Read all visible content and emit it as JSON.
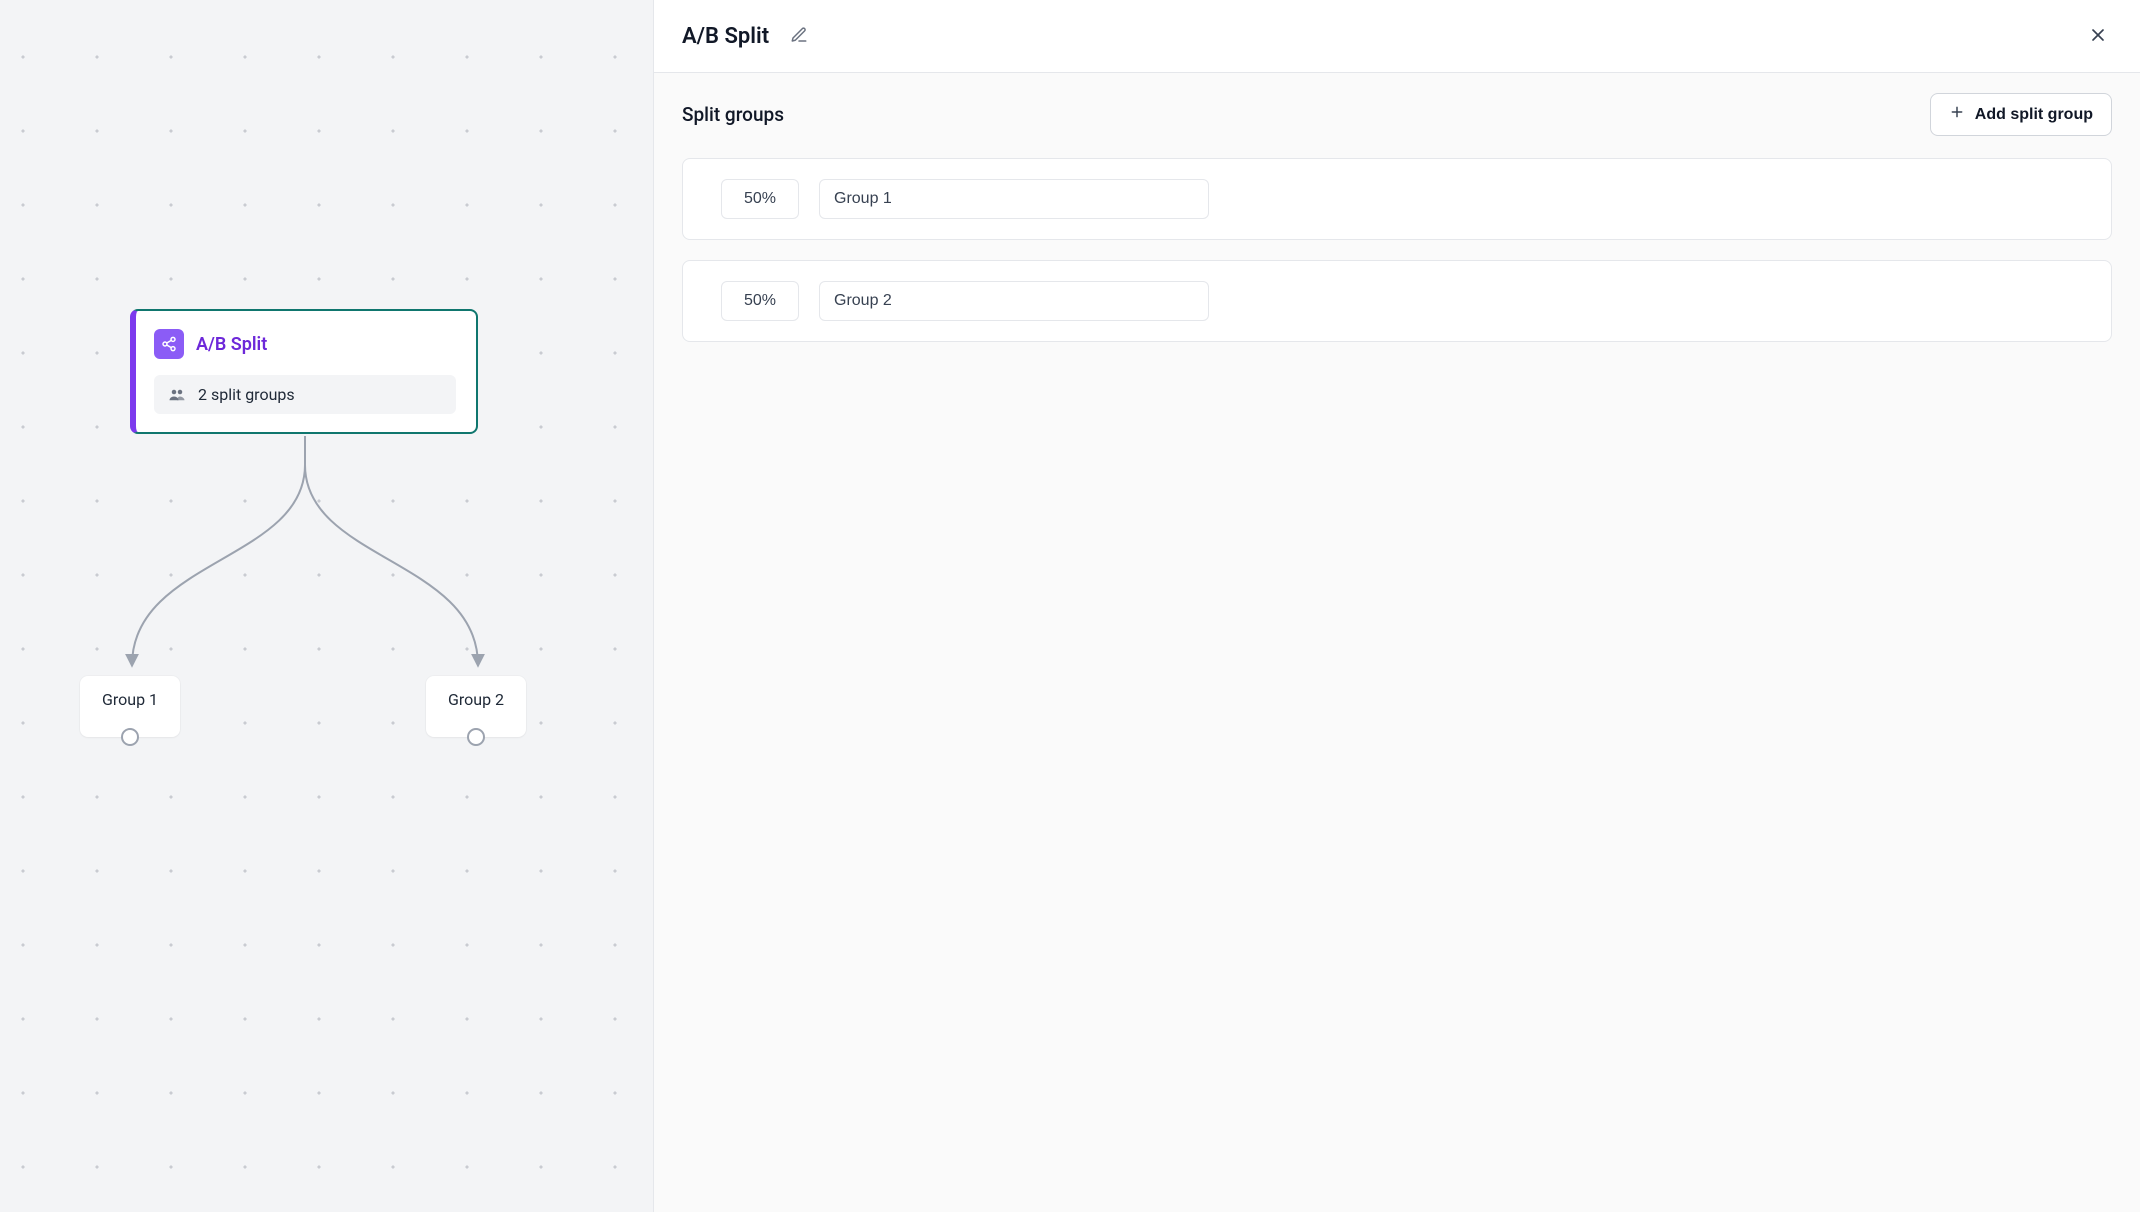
{
  "panel": {
    "title": "A/B Split",
    "section_title": "Split groups",
    "add_button_label": "Add split group"
  },
  "groups": [
    {
      "percent": "50%",
      "name": "Group 1"
    },
    {
      "percent": "50%",
      "name": "Group 2"
    }
  ],
  "canvas": {
    "node_title": "A/B Split",
    "node_status": "2 split groups",
    "branches": [
      {
        "label": "Group 1"
      },
      {
        "label": "Group 2"
      }
    ]
  },
  "colors": {
    "accent": "#7c3aed",
    "node_border": "#0f766e"
  }
}
